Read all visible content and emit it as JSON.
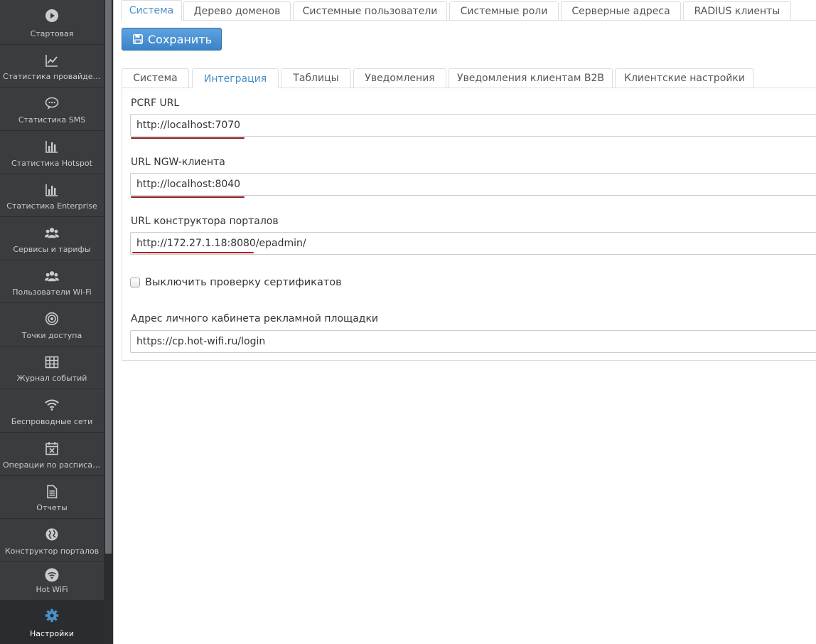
{
  "sidebar": {
    "items": [
      {
        "label": "Стартовая",
        "icon": "play-circle-icon"
      },
      {
        "label": "Статистика провайдера",
        "icon": "line-chart-icon"
      },
      {
        "label": "Статистика SMS",
        "icon": "chat-bubble-icon"
      },
      {
        "label": "Статистика Hotspot",
        "icon": "bar-chart-icon"
      },
      {
        "label": "Статистика Enterprise",
        "icon": "bar-chart-icon"
      },
      {
        "label": "Сервисы и тарифы",
        "icon": "users-group-icon"
      },
      {
        "label": "Пользователи Wi-Fi",
        "icon": "users-group-icon"
      },
      {
        "label": "Точки доступа",
        "icon": "access-point-icon"
      },
      {
        "label": "Журнал событий",
        "icon": "table-grid-icon"
      },
      {
        "label": "Беспроводные сети",
        "icon": "wifi-icon"
      },
      {
        "label": "Операции по расписанию",
        "icon": "calendar-x-icon"
      },
      {
        "label": "Отчеты",
        "icon": "document-icon"
      },
      {
        "label": "Конструктор порталов",
        "icon": "globe-icon"
      },
      {
        "label": "Hot WiFi",
        "icon": "wifi-circle-icon"
      },
      {
        "label": "Настройки",
        "icon": "gear-icon",
        "active": true
      }
    ]
  },
  "top_tabs": [
    {
      "label": "Система",
      "active": true
    },
    {
      "label": "Дерево доменов"
    },
    {
      "label": "Системные пользователи"
    },
    {
      "label": "Системные роли"
    },
    {
      "label": "Серверные адреса"
    },
    {
      "label": "RADIUS клиенты"
    }
  ],
  "toolbar": {
    "save_label": "Сохранить",
    "save_icon": "floppy-disk-icon"
  },
  "sub_tabs": [
    {
      "label": "Система"
    },
    {
      "label": "Интеграция",
      "active": true
    },
    {
      "label": "Таблицы"
    },
    {
      "label": "Уведомления"
    },
    {
      "label": "Уведомления клиентам B2B"
    },
    {
      "label": "Клиентские настройки"
    }
  ],
  "form": {
    "pcrf_label": "PCRF URL",
    "pcrf_value": "http://localhost:7070",
    "ngw_label": "URL NGW-клиента",
    "ngw_value": "http://localhost:8040",
    "portal_label": "URL конструктора порталов",
    "portal_value": "http://172.27.1.18:8080/epadmin/",
    "cert_check_label": "Выключить проверку сертификатов",
    "cert_check_checked": false,
    "ad_cabinet_label": "Адрес личного кабинета рекламной площадки",
    "ad_cabinet_value": "https://cp.hot-wifi.ru/login"
  },
  "colors": {
    "sidebar_bg": "#3a3d40",
    "accent": "#4a90c9",
    "save_button": "#3b82c8",
    "annotation_underline": "#8b1a1a"
  }
}
